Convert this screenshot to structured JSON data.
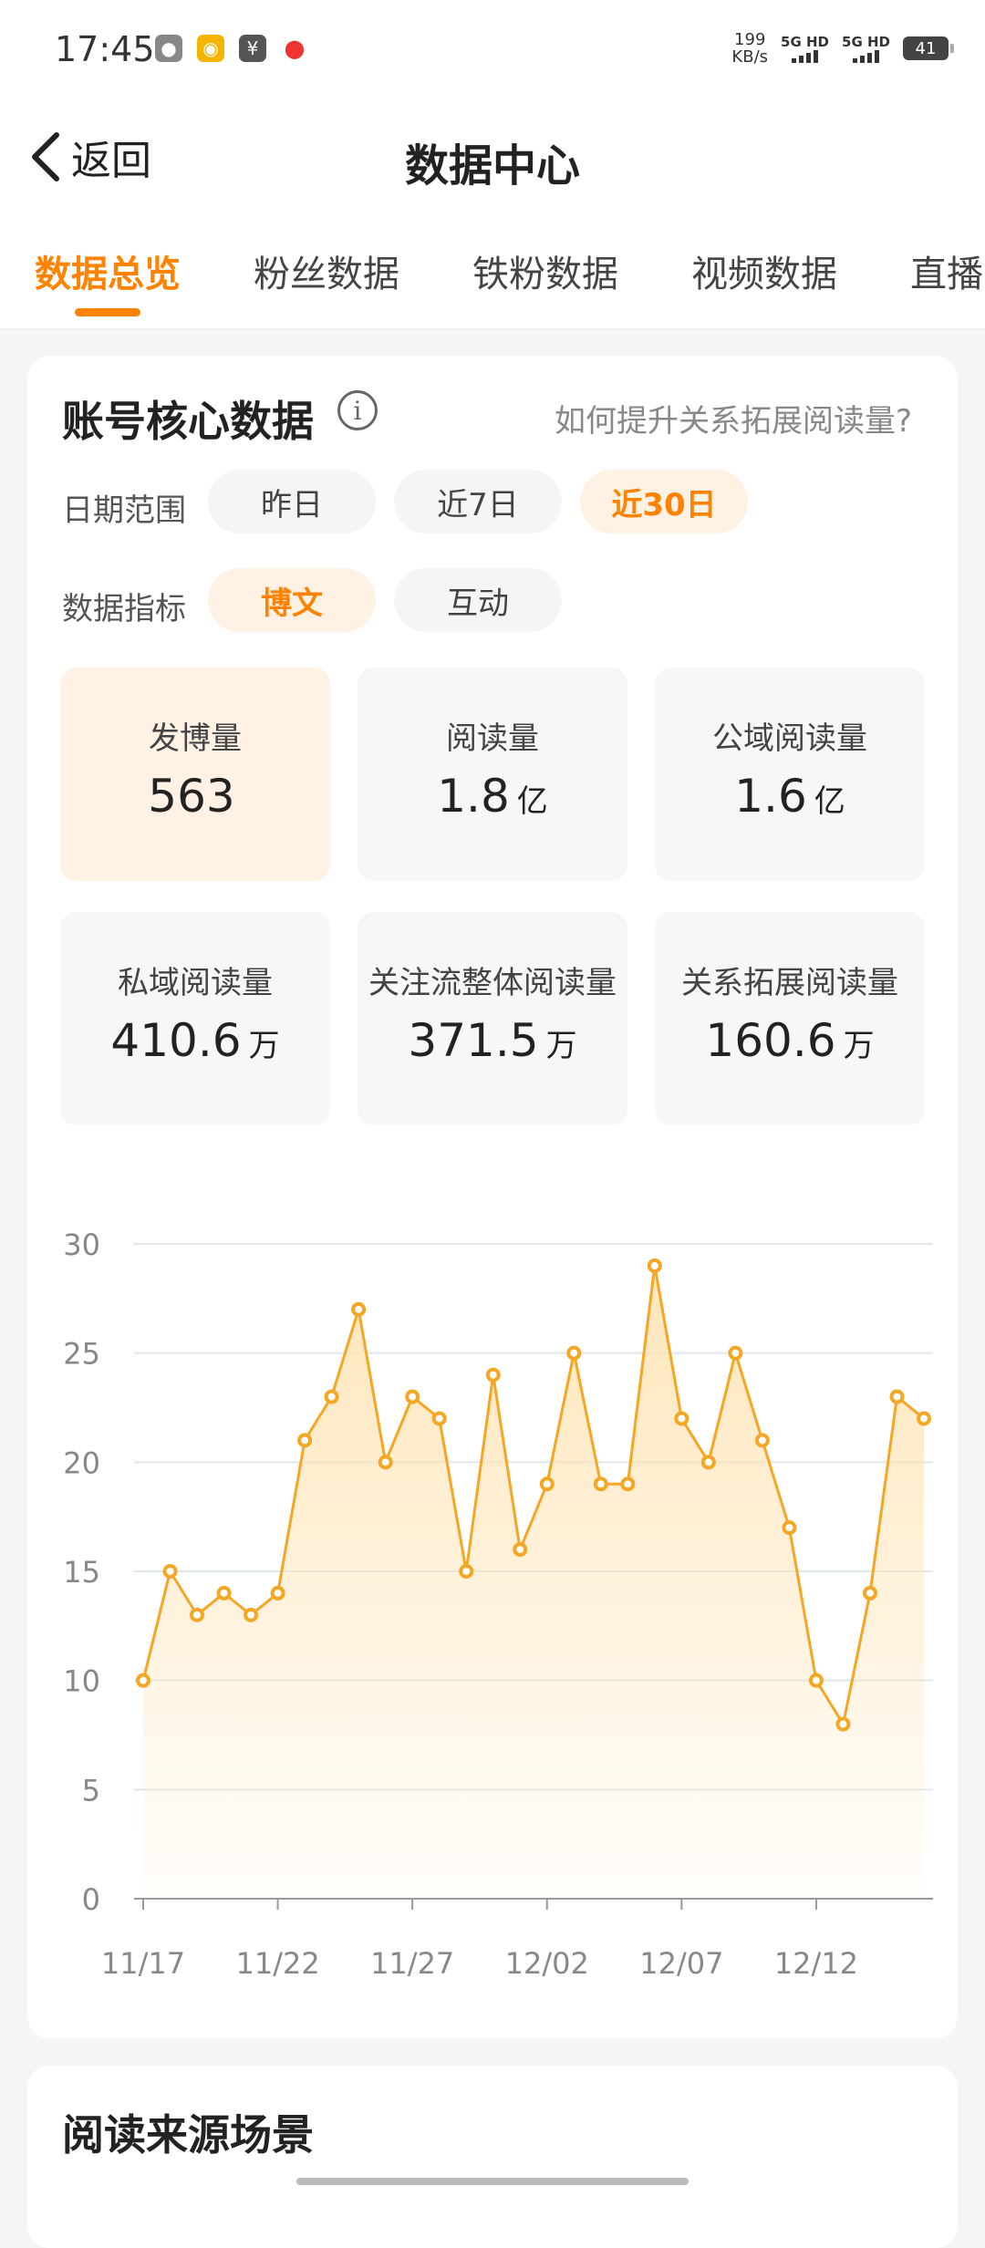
{
  "status": {
    "time": "17:45",
    "net_speed": "199",
    "net_unit": "KB/s",
    "sim1": "5G HD",
    "sim2": "5G HD",
    "battery": "41",
    "apps": [
      "wechat-icon",
      "weibo-icon",
      "yuan-icon",
      "map-pin-icon"
    ]
  },
  "header": {
    "back_label": "返回",
    "title": "数据中心"
  },
  "tabs": [
    "数据总览",
    "粉丝数据",
    "铁粉数据",
    "视频数据",
    "直播"
  ],
  "card": {
    "title": "账号核心数据",
    "info": "i",
    "help_link": "如何提升关系拓展阅读量?",
    "date_range": {
      "label": "日期范围",
      "options": [
        "昨日",
        "近7日",
        "近30日"
      ],
      "selected": "近30日"
    },
    "metric_type": {
      "label": "数据指标",
      "options": [
        "博文",
        "互动"
      ],
      "selected": "博文"
    },
    "metrics": [
      {
        "label": "发博量",
        "value": "563",
        "unit": ""
      },
      {
        "label": "阅读量",
        "value": "1.8",
        "unit": "亿"
      },
      {
        "label": "公域阅读量",
        "value": "1.6",
        "unit": "亿"
      },
      {
        "label": "私域阅读量",
        "value": "410.6",
        "unit": "万"
      },
      {
        "label": "关注流整体阅读量",
        "value": "371.5",
        "unit": "万"
      },
      {
        "label": "关系拓展阅读量",
        "value": "160.6",
        "unit": "万"
      }
    ]
  },
  "chart_data": {
    "type": "area",
    "x": [
      "11/17",
      "11/18",
      "11/19",
      "11/20",
      "11/21",
      "11/22",
      "11/23",
      "11/24",
      "11/25",
      "11/26",
      "11/27",
      "11/28",
      "11/29",
      "11/30",
      "12/01",
      "12/02",
      "12/03",
      "12/04",
      "12/05",
      "12/06",
      "12/07",
      "12/08",
      "12/09",
      "12/10",
      "12/11",
      "12/12",
      "12/13",
      "12/14",
      "12/15",
      "12/16"
    ],
    "values": [
      10,
      15,
      13,
      14,
      13,
      14,
      21,
      23,
      27,
      20,
      23,
      22,
      15,
      24,
      16,
      19,
      25,
      19,
      19,
      29,
      22,
      20,
      25,
      21,
      17,
      10,
      8,
      14,
      23,
      22
    ],
    "x_tick_labels": [
      "11/17",
      "11/22",
      "11/27",
      "12/02",
      "12/07",
      "12/12"
    ],
    "y_ticks": [
      0,
      5,
      10,
      15,
      20,
      25,
      30
    ],
    "ylim": [
      0,
      30
    ],
    "grid": true,
    "color": "#f5a623",
    "fill_color": "#ffe3b3"
  },
  "section2": {
    "title": "阅读来源场景"
  }
}
